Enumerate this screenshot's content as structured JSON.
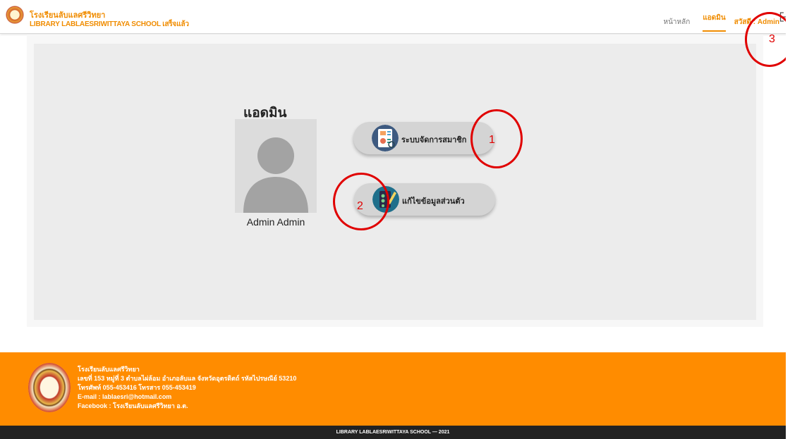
{
  "header": {
    "school_name_th": "โรงเรียนลับแลศรีวิทยา",
    "school_name_en": "LIBRARY LABLAESRIWITTAYA SCHOOL เสร็จแล้ว",
    "nav": {
      "home": "หน้าหลัก",
      "admin": "แอดมิน",
      "greeting": "สวัสดี : Admin"
    },
    "logout_icon": "logout-icon"
  },
  "main": {
    "title": "แอดมิน",
    "user_name": "Admin Admin",
    "buttons": {
      "members": "ระบบจัดการสมาชิก",
      "profile": "แก้ไขข้อมูลส่วนตัว"
    }
  },
  "markers": {
    "m1": "1",
    "m2": "2",
    "m3": "3",
    "color": "#e00000"
  },
  "footer": {
    "name": "โรงเรียนลับแลศรีวิทยา",
    "address": "เลขที่ 153 หมู่ที่ 3 ตำบลไผ่ล้อม อำเภอลับแล จังหวัดอุตรดิตถ์ รหัสไปรษณีย์ 53210",
    "phone": "โทรศัพท์ 055-453416 โทรสาร 055-453419",
    "email": "E-mail : lablaesri@hotmail.com",
    "facebook": "Facebook : โรงเรียนลับแลศรีวิทยา อ.ต.",
    "copyright": "LIBRARY LABLAESRIWITTAYA SCHOOL — 2021"
  },
  "colors": {
    "accent": "#f08c00",
    "footer_bg": "#ff8c00",
    "bottom_bar": "#222222"
  }
}
